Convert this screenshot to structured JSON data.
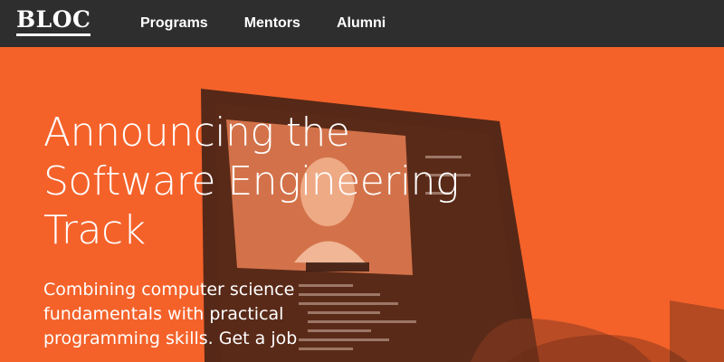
{
  "nav": {
    "logo": "BLOC",
    "links": [
      "Programs",
      "Mentors",
      "Alumni"
    ]
  },
  "hero": {
    "headline_lines": [
      "Announcing the",
      "Software Engineering",
      "Track"
    ],
    "subtext_lines": [
      "Combining computer science",
      "fundamentals with practical",
      "programming skills. Get a job"
    ]
  },
  "colors": {
    "navbar": "#2e2e2e",
    "hero_orange": "#f4622a"
  }
}
